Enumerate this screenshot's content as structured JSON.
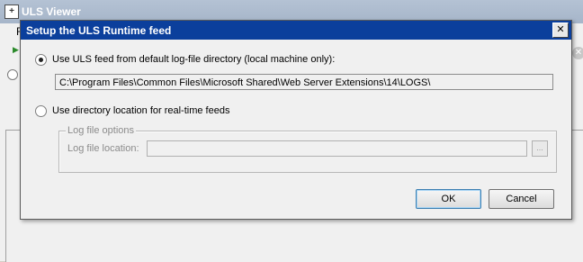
{
  "app": {
    "title": "ULS Viewer",
    "menu_letter": "F"
  },
  "dialog": {
    "title": "Setup the ULS Runtime feed",
    "close_glyph": "✕",
    "option_default": {
      "label": "Use ULS feed from default log-file directory (local machine only):",
      "selected": true,
      "path": "C:\\Program Files\\Common Files\\Microsoft Shared\\Web Server Extensions\\14\\LOGS\\"
    },
    "option_directory": {
      "label": "Use directory location for real-time feeds",
      "selected": false
    },
    "log_file_options": {
      "legend": "Log file options",
      "location_label": "Log file location:",
      "location_value": "",
      "browse_label": "..."
    },
    "buttons": {
      "ok": "OK",
      "cancel": "Cancel"
    }
  },
  "colors": {
    "dialog_titlebar": "#0b3f9c",
    "disabled_text": "#8c8c8c"
  }
}
